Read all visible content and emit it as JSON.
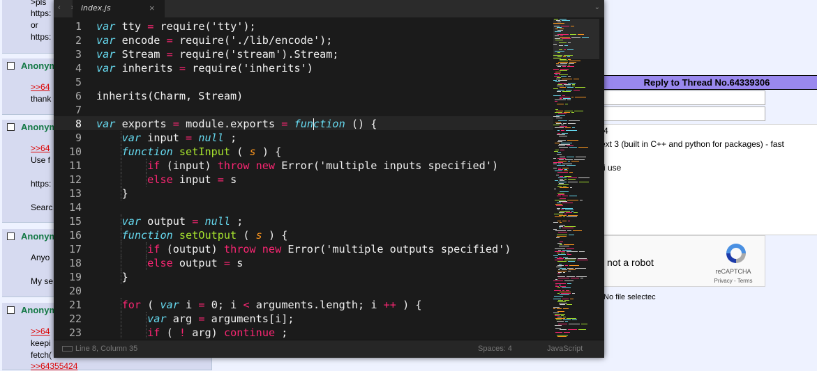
{
  "background": {
    "posts": [
      {
        "lines": [
          "https:",
          "or",
          "https:"
        ],
        "greentext": ">pls"
      },
      {
        "name": "Anonym",
        "lines": [
          ">>64",
          "thank"
        ]
      },
      {
        "name": "Anonym",
        "lines": [
          ">>64",
          "Use f",
          "https:",
          "Searc"
        ]
      },
      {
        "name": "Anonym",
        "lines": [
          "Anyo",
          "My se"
        ]
      },
      {
        "name": "Anonym",
        "lines": [
          ">>64",
          "keepi",
          "fetch(",
          ">>64355424"
        ]
      }
    ],
    "reply": {
      "title": "Reply to Thread No.64339306",
      "form_line1": "4",
      "form_line2": "ext 3 (built in C++ and python for packages) - fast",
      "form_line3": "i use",
      "captcha_text": "not a robot",
      "captcha_brand": "reCAPTCHA",
      "captcha_links": "Privacy - Terms",
      "file_status": "No file selectec"
    }
  },
  "editor": {
    "tab_label": "index.js",
    "tab_close": "×",
    "nav_arrows": "‹ ›",
    "tab_menu": "⌄",
    "line_numbers": [
      "1",
      "2",
      "3",
      "4",
      "5",
      "6",
      "7",
      "8",
      "9",
      "10",
      "11",
      "12",
      "13",
      "14",
      "15",
      "16",
      "17",
      "18",
      "19",
      "20",
      "21",
      "22",
      "23"
    ],
    "current_line": "8",
    "code_lines": [
      [
        [
          "kw",
          "var"
        ],
        [
          "",
          "tty"
        ],
        [
          "red",
          "="
        ],
        [
          "",
          "require('tty');"
        ]
      ],
      [
        [
          "kw",
          "var"
        ],
        [
          "",
          "encode"
        ],
        [
          "red",
          "="
        ],
        [
          "",
          "require('./lib/encode');"
        ]
      ],
      [
        [
          "kw",
          "var"
        ],
        [
          "",
          "Stream"
        ],
        [
          "red",
          "="
        ],
        [
          "",
          "require('stream').Stream;"
        ]
      ],
      [
        [
          "kw",
          "var"
        ],
        [
          "",
          "inherits"
        ],
        [
          "red",
          "="
        ],
        [
          "",
          "require('inherits')"
        ]
      ],
      [],
      [
        [
          "",
          "inherits(Charm, Stream)"
        ]
      ],
      [],
      [
        [
          "kw",
          "var"
        ],
        [
          "",
          "exports"
        ],
        [
          "red",
          "="
        ],
        [
          "",
          "module.exports"
        ],
        [
          "red",
          "="
        ],
        [
          "kw",
          "fun|ction"
        ],
        [
          "",
          "() {"
        ]
      ],
      [
        [
          "ind1",
          ""
        ],
        [
          "kw",
          "var"
        ],
        [
          "",
          "input"
        ],
        [
          "red",
          "="
        ],
        [
          "kw",
          "null"
        ],
        [
          "",
          ";"
        ]
      ],
      [
        [
          "ind1",
          ""
        ],
        [
          "kw",
          "function"
        ],
        [
          "fn",
          "setInput"
        ],
        [
          "",
          "("
        ],
        [
          "it",
          "s"
        ],
        [
          "",
          ") {"
        ]
      ],
      [
        [
          "ind2",
          ""
        ],
        [
          "red",
          "if"
        ],
        [
          "",
          "(input)"
        ],
        [
          "red",
          "throw new"
        ],
        [
          "",
          "Error('multiple inputs specified')"
        ]
      ],
      [
        [
          "ind2",
          ""
        ],
        [
          "red",
          "else"
        ],
        [
          "",
          "input"
        ],
        [
          "red",
          "="
        ],
        [
          "",
          "s"
        ]
      ],
      [
        [
          "ind1",
          ""
        ],
        [
          "",
          "}"
        ]
      ],
      [],
      [
        [
          "ind1",
          ""
        ],
        [
          "kw",
          "var"
        ],
        [
          "",
          "output"
        ],
        [
          "red",
          "="
        ],
        [
          "kw",
          "null"
        ],
        [
          "",
          ";"
        ]
      ],
      [
        [
          "ind1",
          ""
        ],
        [
          "kw",
          "function"
        ],
        [
          "fn",
          "setOutput"
        ],
        [
          "",
          "("
        ],
        [
          "it",
          "s"
        ],
        [
          "",
          ") {"
        ]
      ],
      [
        [
          "ind2",
          ""
        ],
        [
          "red",
          "if"
        ],
        [
          "",
          "(output)"
        ],
        [
          "red",
          "throw new"
        ],
        [
          "",
          "Error('multiple outputs specified')"
        ]
      ],
      [
        [
          "ind2",
          ""
        ],
        [
          "red",
          "else"
        ],
        [
          "",
          "output"
        ],
        [
          "red",
          "="
        ],
        [
          "",
          "s"
        ]
      ],
      [
        [
          "ind1",
          ""
        ],
        [
          "",
          "}"
        ]
      ],
      [],
      [
        [
          "ind1",
          ""
        ],
        [
          "red",
          "for"
        ],
        [
          "",
          "("
        ],
        [
          "kw",
          "var"
        ],
        [
          "",
          "i"
        ],
        [
          "red",
          "="
        ],
        [
          "",
          "0; i"
        ],
        [
          "red",
          "<"
        ],
        [
          "",
          "arguments.length; i"
        ],
        [
          "red",
          "++"
        ],
        [
          "",
          ") {"
        ]
      ],
      [
        [
          "ind2",
          ""
        ],
        [
          "kw",
          "var"
        ],
        [
          "",
          "arg"
        ],
        [
          "red",
          "="
        ],
        [
          "",
          "arguments[i];"
        ]
      ],
      [
        [
          "ind2",
          ""
        ],
        [
          "red",
          "if"
        ],
        [
          "",
          "("
        ],
        [
          "red",
          "!"
        ],
        [
          "",
          "arg)"
        ],
        [
          "red",
          "continue"
        ],
        [
          "",
          ";"
        ]
      ]
    ],
    "code_text": [
      "var tty = require('tty');",
      "var encode = require('./lib/encode');",
      "var Stream = require('stream').Stream;",
      "var inherits = require('inherits')",
      "",
      "inherits(Charm, Stream)",
      "",
      "var exports = module.exports = function () {",
      "    var input = null;",
      "    function setInput (s) {",
      "        if (input) throw new Error('multiple inputs specified')",
      "        else input = s",
      "    }",
      "",
      "    var output = null;",
      "    function setOutput (s) {",
      "        if (output) throw new Error('multiple outputs specified')",
      "        else output = s",
      "    }",
      "",
      "    for (var i = 0; i < arguments.length; i++) {",
      "        var arg = arguments[i];",
      "        if (!arg) continue;"
    ],
    "status": {
      "position": "Line 8, Column 35",
      "spaces": "Spaces: 4",
      "language": "JavaScript"
    }
  },
  "colors": {
    "editor_bg": "#1b1b1b",
    "keyword": "#66d9ef",
    "operator": "#f92672",
    "function_name": "#a6e22e",
    "parameter": "#fd971f",
    "forum_name": "#117743",
    "reply_header": "#9988ee"
  }
}
